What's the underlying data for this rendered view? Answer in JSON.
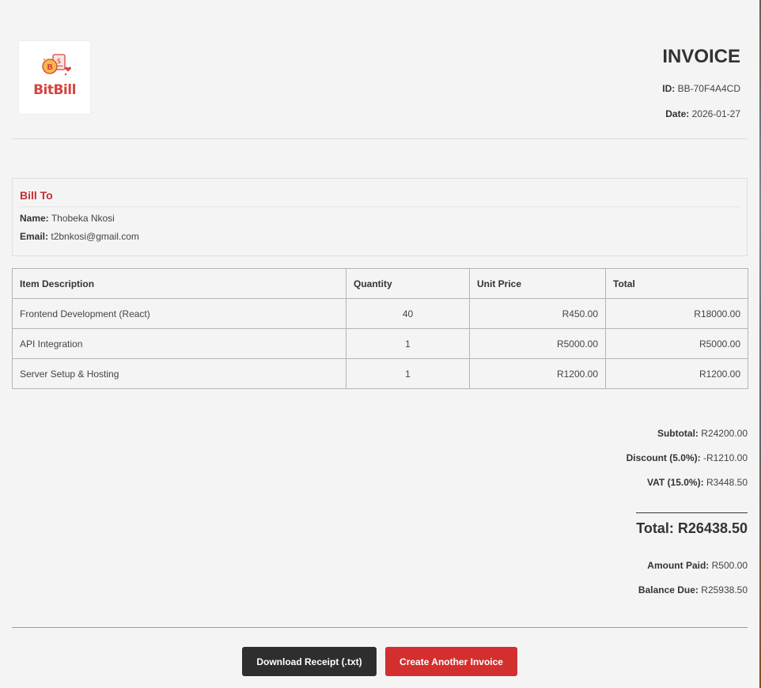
{
  "logo": {
    "text": "BitBill",
    "icon": "coin-receipt-icon",
    "brand_color": "#d6443f"
  },
  "invoice": {
    "title": "INVOICE",
    "id_label": "ID:",
    "id": "BB-70F4A4CD",
    "date_label": "Date:",
    "date": "2026-01-27"
  },
  "bill_to": {
    "title": "Bill To",
    "name_label": "Name:",
    "name": "Thobeka Nkosi",
    "email_label": "Email:",
    "email": "t2bnkosi@gmail.com"
  },
  "table": {
    "headers": [
      "Item Description",
      "Quantity",
      "Unit Price",
      "Total"
    ],
    "rows": [
      {
        "description": "Frontend Development (React)",
        "quantity": "40",
        "unit_price": "R450.00",
        "total": "R18000.00"
      },
      {
        "description": "API Integration",
        "quantity": "1",
        "unit_price": "R5000.00",
        "total": "R5000.00"
      },
      {
        "description": "Server Setup & Hosting",
        "quantity": "1",
        "unit_price": "R1200.00",
        "total": "R1200.00"
      }
    ]
  },
  "summary": {
    "subtotal_label": "Subtotal:",
    "subtotal": "R24200.00",
    "discount_label": "Discount (5.0%):",
    "discount": "-R1210.00",
    "vat_label": "VAT (15.0%):",
    "vat": "R3448.50",
    "total_text": "Total: R26438.50",
    "amount_paid_label": "Amount Paid:",
    "amount_paid": "R500.00",
    "balance_due_label": "Balance Due:",
    "balance_due": "R25938.50"
  },
  "actions": {
    "download_label": "Download Receipt (.txt)",
    "create_label": "Create Another Invoice"
  },
  "colors": {
    "accent": "#d32f2f",
    "dark_button": "#2e2e2e",
    "background": "#f4f4f5"
  }
}
